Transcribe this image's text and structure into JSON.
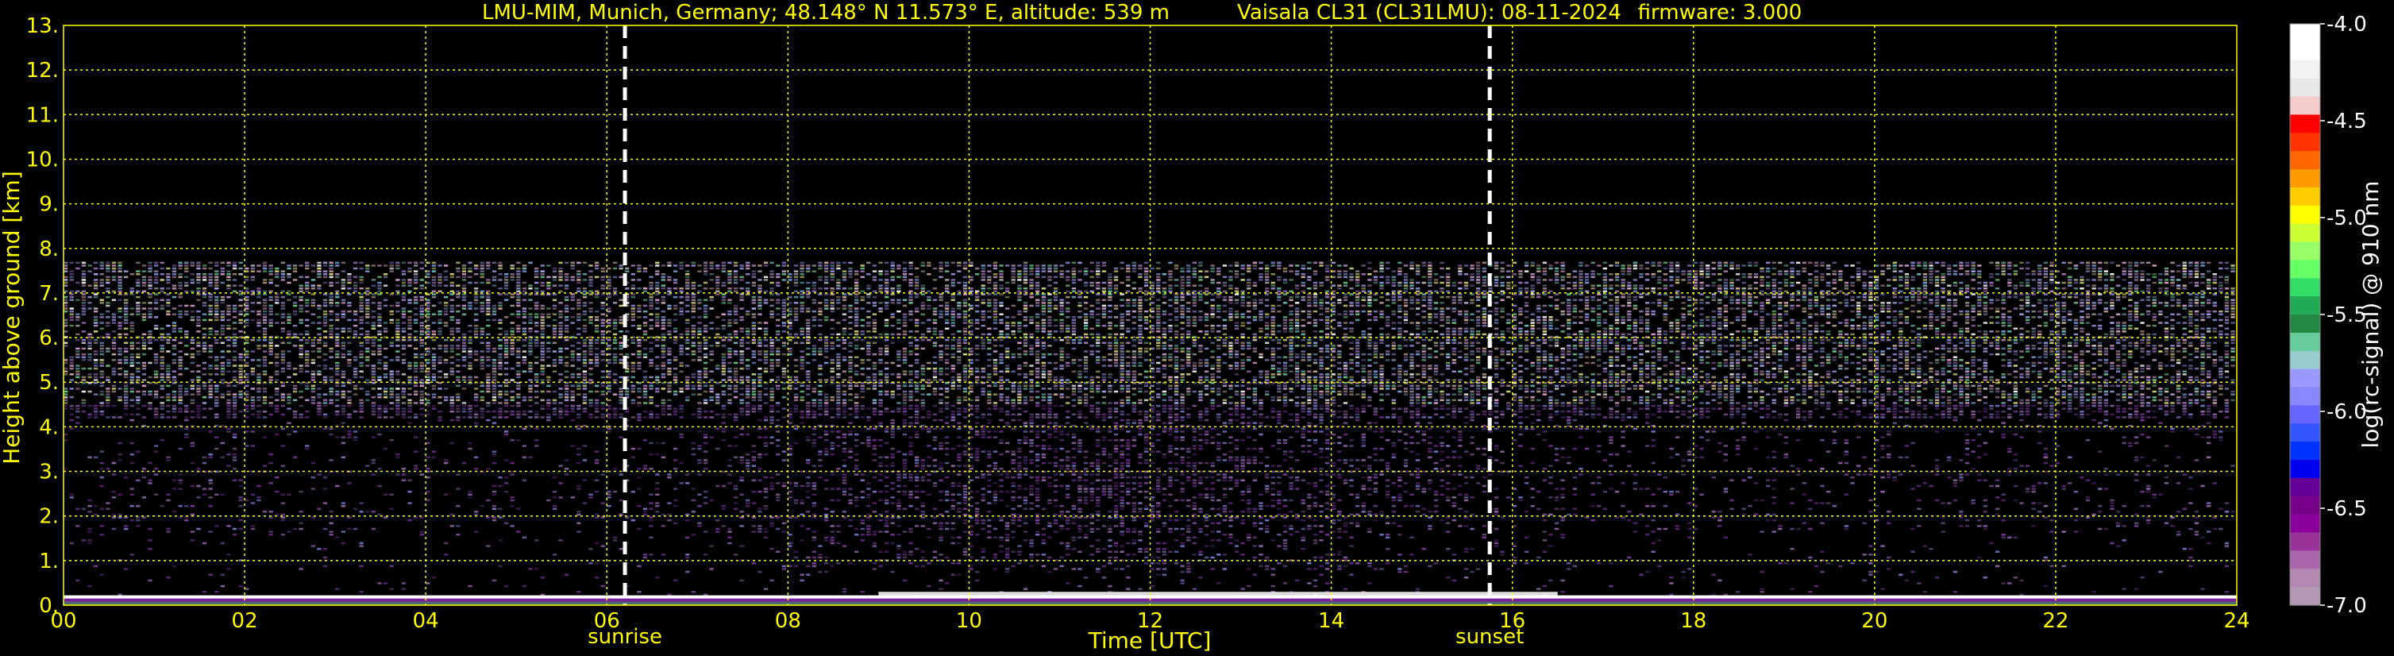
{
  "title": {
    "location": "LMU-MIM, Munich, Germany; 48.148° N 11.573° E, altitude: 539 m",
    "instrument": "Vaisala CL31 (CL31LMU): 08-11-2024",
    "firmware": "firmware: 3.000"
  },
  "chart_data": {
    "type": "heatmap",
    "title": "LMU-MIM, Munich, Germany; 48.148° N 11.573° E, altitude: 539 m    Vaisala CL31 (CL31LMU): 08-11-2024    firmware: 3.000",
    "xlabel": "Time [UTC]",
    "ylabel": "Height above ground [km]",
    "xlim": [
      0,
      24
    ],
    "ylim": [
      0,
      13
    ],
    "x_ticks": [
      "00",
      "02",
      "04",
      "06",
      "08",
      "10",
      "12",
      "14",
      "16",
      "18",
      "20",
      "22",
      "24"
    ],
    "y_ticks": [
      "0.",
      "1.",
      "2.",
      "3.",
      "4.",
      "5.",
      "6.",
      "7.",
      "8.",
      "9.",
      "10.",
      "11.",
      "12.",
      "13."
    ],
    "grid": true,
    "grid_color": "#ffff00",
    "annotations": [
      {
        "label": "sunrise",
        "x": 6.2
      },
      {
        "label": "sunset",
        "x": 15.75
      }
    ],
    "signal_top_km": 7.7,
    "colorbar": {
      "label": "log(rc-signal) @ 910 nm",
      "range": [
        -7.0,
        -4.0
      ],
      "ticks": [
        "-4.0",
        "-4.5",
        "-5.0",
        "-5.5",
        "-6.0",
        "-6.5",
        "-7.0"
      ],
      "colors": [
        "#ffffff",
        "#ffffff",
        "#f2f2f2",
        "#e8e8e8",
        "#f4cccc",
        "#ff0000",
        "#ff3300",
        "#ff6600",
        "#ff9900",
        "#ffcc00",
        "#ffff00",
        "#ccff33",
        "#99ff66",
        "#66ff66",
        "#33dd66",
        "#22aa55",
        "#228844",
        "#66cc99",
        "#99cccc",
        "#9999ff",
        "#8888ff",
        "#6666ff",
        "#3355ff",
        "#0033ff",
        "#0000ee",
        "#660099",
        "#770088",
        "#880099",
        "#993399",
        "#aa66aa",
        "#b388b3",
        "#b399b3"
      ]
    }
  }
}
